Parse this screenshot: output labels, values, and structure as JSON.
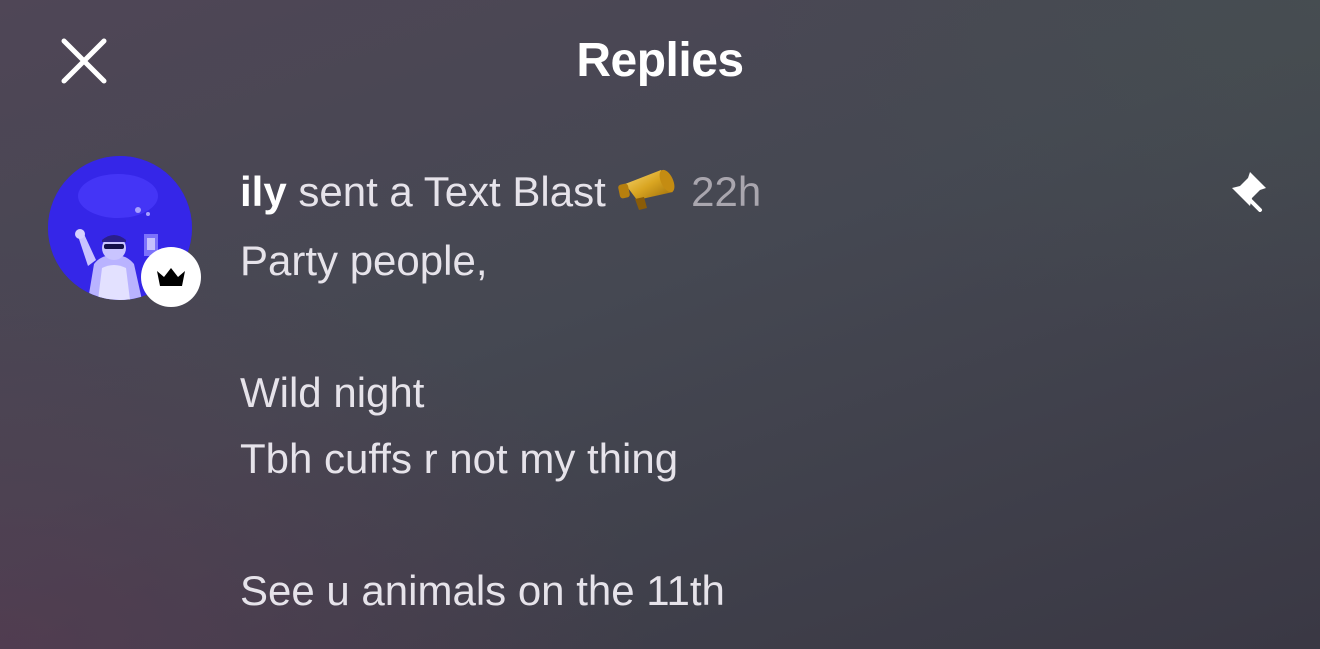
{
  "header": {
    "title": "Replies",
    "close_icon": "close-icon"
  },
  "post": {
    "author": "ily",
    "action": "sent a Text Blast",
    "action_icon": "megaphone-icon",
    "timestamp": "22h",
    "pin_icon": "pin-icon",
    "avatar_badge_icon": "crown-icon",
    "message_lines": [
      "Party people,",
      "",
      "Wild night",
      "Tbh cuffs r not my thing",
      "",
      "See u animals on the 11th"
    ]
  },
  "colors": {
    "background": "#484650",
    "text_primary": "#ffffff",
    "text_secondary": "#e6e3ea",
    "timestamp": "#a9a6ae",
    "avatar_blue": "#3a2cf0"
  }
}
